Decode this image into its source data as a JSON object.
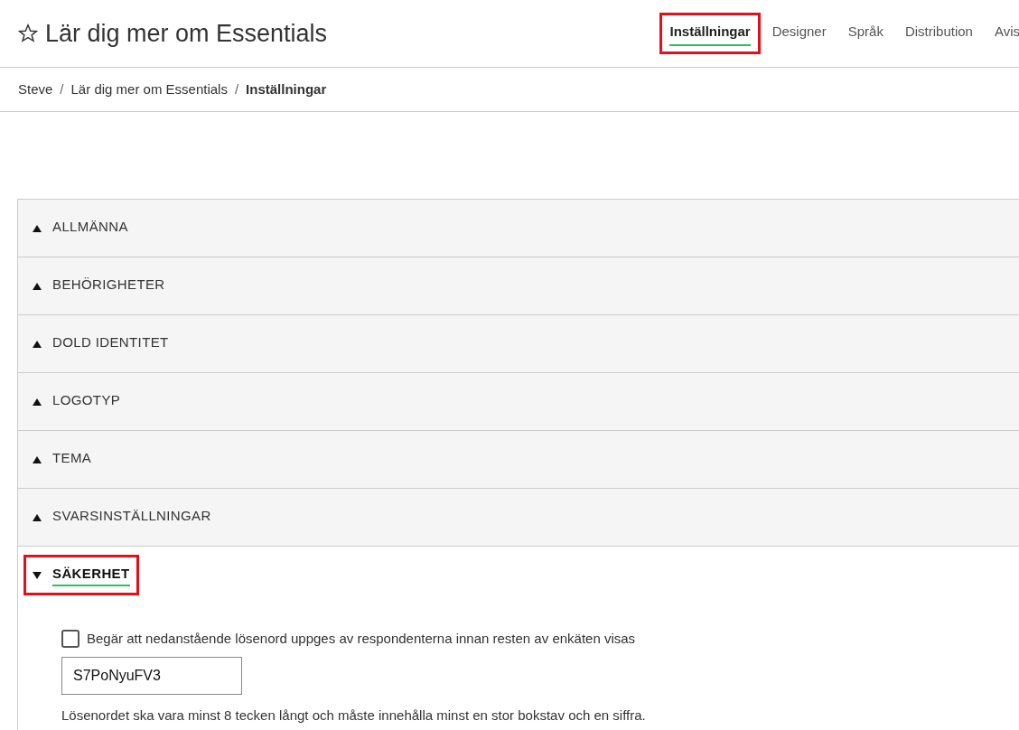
{
  "header": {
    "title": "Lär dig mer om Essentials",
    "favorite": false
  },
  "tabs": [
    {
      "label": "Inställningar",
      "selected": true,
      "highlighted": true
    },
    {
      "label": "Designer",
      "selected": false,
      "highlighted": false
    },
    {
      "label": "Språk",
      "selected": false,
      "highlighted": false
    },
    {
      "label": "Distribution",
      "selected": false,
      "highlighted": false
    },
    {
      "label": "Avis",
      "selected": false,
      "highlighted": false
    }
  ],
  "breadcrumb": [
    {
      "label": "Steve",
      "current": false
    },
    {
      "separator": "/",
      "label": "Lär dig mer om Essentials",
      "current": false
    },
    {
      "separator": "/",
      "label": "Inställningar",
      "current": true
    }
  ],
  "sections": [
    {
      "title": "ALLMÄNNA",
      "expanded": false,
      "highlighted": false
    },
    {
      "title": "BEHÖRIGHETER",
      "expanded": false,
      "highlighted": false
    },
    {
      "title": "DOLD IDENTITET",
      "expanded": false,
      "highlighted": false
    },
    {
      "title": "LOGOTYP",
      "expanded": false,
      "highlighted": false
    },
    {
      "title": "TEMA",
      "expanded": false,
      "highlighted": false
    },
    {
      "title": "SVARSINSTÄLLNINGAR",
      "expanded": false,
      "highlighted": false
    },
    {
      "title": "SÄKERHET",
      "expanded": true,
      "highlighted": true,
      "content": {
        "checkbox": {
          "label": "Begär att nedanstående lösenord uppges av respondenterna innan resten av enkäten visas",
          "checked": false
        },
        "password": {
          "value": "S7PoNyuFV3"
        },
        "hint": "Lösenordet ska vara minst 8 tecken långt och måste innehålla minst en stor bokstav och en siffra."
      }
    }
  ]
}
